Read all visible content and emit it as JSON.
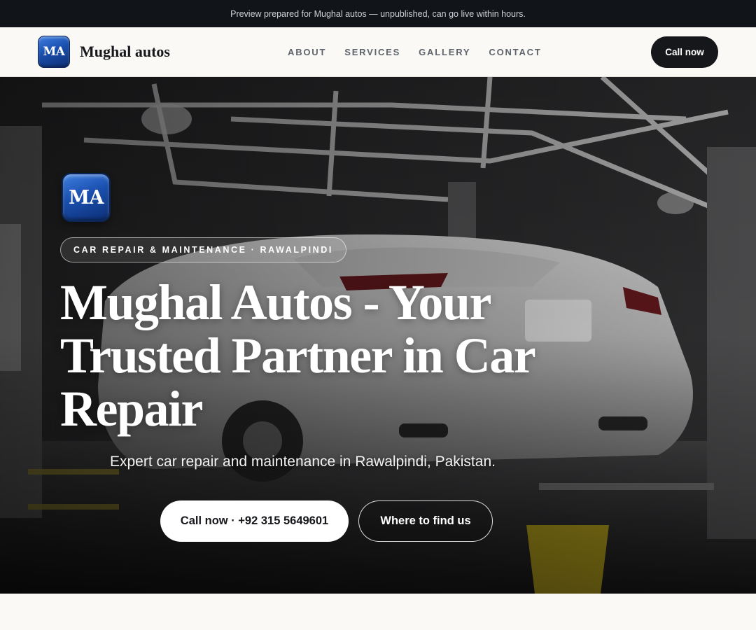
{
  "banner": {
    "text": "Preview prepared for Mughal autos — unpublished, can go live within hours."
  },
  "header": {
    "logo_text": "MA",
    "brand_name": "Mughal autos",
    "nav": [
      {
        "label": "ABOUT"
      },
      {
        "label": "SERVICES"
      },
      {
        "label": "GALLERY"
      },
      {
        "label": "CONTACT"
      }
    ],
    "cta_label": "Call now"
  },
  "hero": {
    "logo_text": "MA",
    "eyebrow": "CAR REPAIR & MAINTENANCE · RAWALPINDI",
    "title": "Mughal Autos - Your Trusted Partner in Car Repair",
    "subtitle": "Expert car repair and maintenance in Rawalpindi, Pakistan.",
    "primary_button": "Call now · +92 315 5649601",
    "secondary_button": "Where to find us",
    "background_image": "garage-car-photo"
  },
  "colors": {
    "banner_bg": "#111418",
    "nav_bg": "#faf9f6",
    "cta_bg": "#15171b",
    "logo_blue": "#1a4fae"
  }
}
